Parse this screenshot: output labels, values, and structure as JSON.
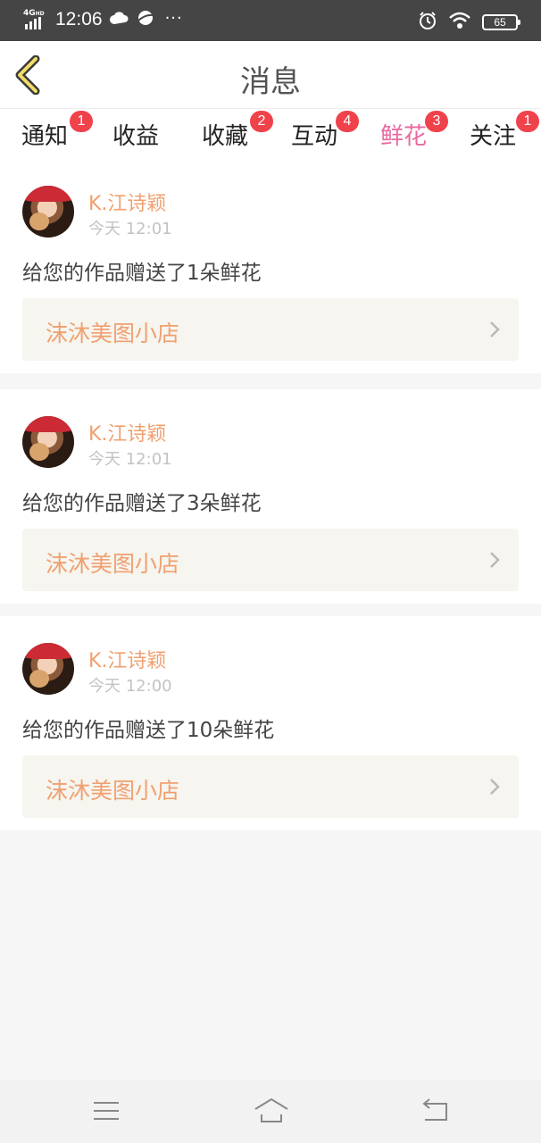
{
  "status": {
    "network": "4G",
    "network_sub": "HD",
    "time": "12:06",
    "more": "···",
    "battery": "65",
    "icons": [
      "cloud-icon",
      "planet-icon",
      "alarm-icon",
      "wifi-icon",
      "battery-icon"
    ]
  },
  "header": {
    "title": "消息",
    "back_icon": "chevron-left-icon"
  },
  "tabs": [
    {
      "label": "通知",
      "badge": "1",
      "active": false
    },
    {
      "label": "收益",
      "badge": "",
      "active": false
    },
    {
      "label": "收藏",
      "badge": "2",
      "active": false
    },
    {
      "label": "互动",
      "badge": "4",
      "active": false
    },
    {
      "label": "鲜花",
      "badge": "3",
      "active": true
    },
    {
      "label": "关注",
      "badge": "1",
      "active": false
    }
  ],
  "messages": [
    {
      "name": "K.江诗颖",
      "time": "今天 12:01",
      "text": "给您的作品赠送了1朵鲜花",
      "shop": "沫沐美图小店"
    },
    {
      "name": "K.江诗颖",
      "time": "今天 12:01",
      "text": "给您的作品赠送了3朵鲜花",
      "shop": "沫沐美图小店"
    },
    {
      "name": "K.江诗颖",
      "time": "今天 12:00",
      "text": "给您的作品赠送了10朵鲜花",
      "shop": "沫沐美图小店"
    }
  ],
  "nav": {
    "icons": [
      "menu-icon",
      "home-icon",
      "back-icon"
    ]
  },
  "colors": {
    "accent": "#e56aa1",
    "badge": "#f0424b",
    "name": "#f0a070",
    "status_bar": "#454545"
  }
}
